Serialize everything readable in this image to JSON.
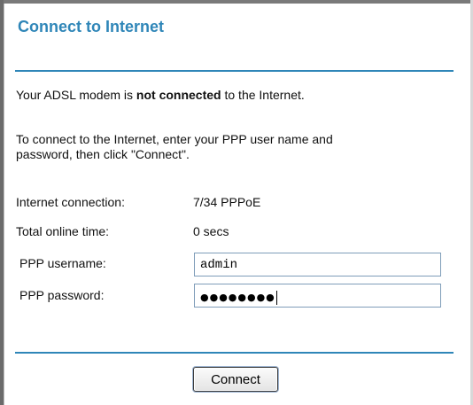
{
  "page": {
    "title": "Connect to Internet"
  },
  "status": {
    "prefix": "Your ADSL modem is ",
    "emphasis": "not connected",
    "suffix": " to the Internet."
  },
  "instructions": {
    "line1": "To connect to the Internet, enter your PPP user name and",
    "line2": "password, then click \"Connect\"."
  },
  "info": {
    "connection_label": "Internet connection:",
    "connection_value": "7/34  PPPoE",
    "online_label": "Total online time:",
    "online_value": "0 secs"
  },
  "form": {
    "username_label": "PPP username:",
    "username_value": "admin",
    "password_label": "PPP password:",
    "password_masked": "●●●●●●●●"
  },
  "actions": {
    "connect_label": "Connect"
  },
  "colors": {
    "accent": "#2f86b8"
  }
}
